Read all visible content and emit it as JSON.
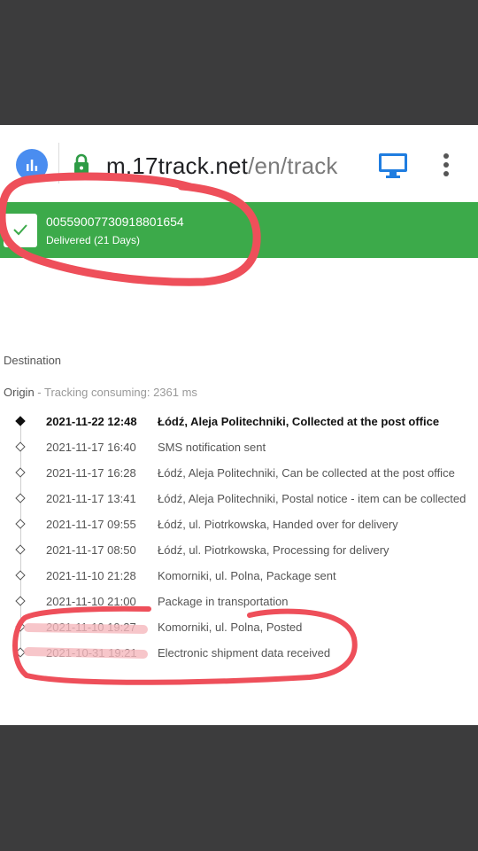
{
  "browser": {
    "url_host": "m.17track.net",
    "url_path": "/en/track"
  },
  "tracking": {
    "number": "00559007730918801654",
    "status": "Delivered (21 Days)"
  },
  "destination_label": "Destination",
  "origin": {
    "label": "Origin",
    "meta": " - Tracking consuming: 2361 ms"
  },
  "events": [
    {
      "date": "2021-11-22 12:48",
      "desc": "Łódź, Aleja Politechniki, Collected at the post office"
    },
    {
      "date": "2021-11-17 16:40",
      "desc": "SMS notification sent"
    },
    {
      "date": "2021-11-17 16:28",
      "desc": "Łódź, Aleja Politechniki, Can be collected at the post office"
    },
    {
      "date": "2021-11-17 13:41",
      "desc": "Łódź, Aleja Politechniki, Postal notice - item can be collected"
    },
    {
      "date": "2021-11-17 09:55",
      "desc": "Łódź, ul. Piotrkowska, Handed over for delivery"
    },
    {
      "date": "2021-11-17 08:50",
      "desc": "Łódź, ul. Piotrkowska, Processing for delivery"
    },
    {
      "date": "2021-11-10 21:28",
      "desc": "Komorniki, ul. Polna, Package sent"
    },
    {
      "date": "2021-11-10 21:00",
      "desc": "Package in transportation"
    },
    {
      "date": "2021-11-10 19:27",
      "desc": "Komorniki, ul. Polna, Posted"
    },
    {
      "date": "2021-10-31 19:21",
      "desc": "Electronic shipment data received"
    }
  ],
  "colors": {
    "delivered_green": "#3caa4a",
    "annotation_red": "#ee4f5a",
    "menu_blue": "#4a8df0"
  },
  "icons": [
    "chart-icon",
    "lock-icon",
    "desktop-icon",
    "kebab-menu-icon",
    "check-icon"
  ]
}
